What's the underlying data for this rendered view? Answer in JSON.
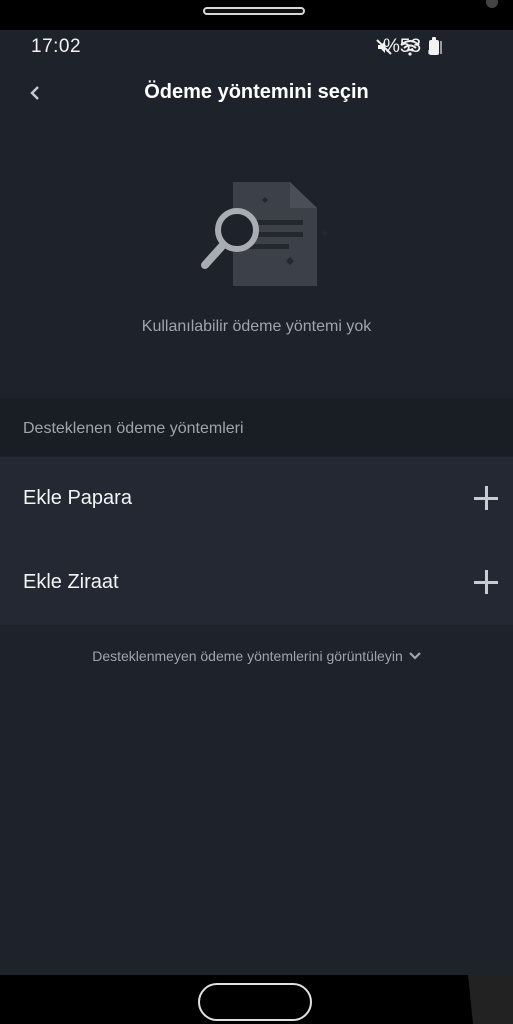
{
  "statusbar": {
    "time": "17:02",
    "battery_percent": "%53",
    "icons": [
      "mute-icon",
      "wifi-icon",
      "signal-icon",
      "battery-icon"
    ]
  },
  "header": {
    "back_icon": "chevron-left-icon",
    "title": "Ödeme yöntemini seçin"
  },
  "empty_state": {
    "illustration": "document-search-icon",
    "message": "Kullanılabilir ödeme yöntemi yok"
  },
  "supported": {
    "section_label": "Desteklenen ödeme yöntemleri",
    "items": [
      {
        "label": "Ekle Papara",
        "icon": "plus-icon"
      },
      {
        "label": "Ekle Ziraat",
        "icon": "plus-icon"
      }
    ]
  },
  "unsupported_link": {
    "label": "Desteklenmeyen ödeme yöntemlerini görüntüleyin",
    "icon": "chevron-down-icon"
  },
  "colors": {
    "background": "#1e222b",
    "section_bg": "#191d24",
    "row_bg": "#232832",
    "muted_text": "#a0a4ad"
  }
}
